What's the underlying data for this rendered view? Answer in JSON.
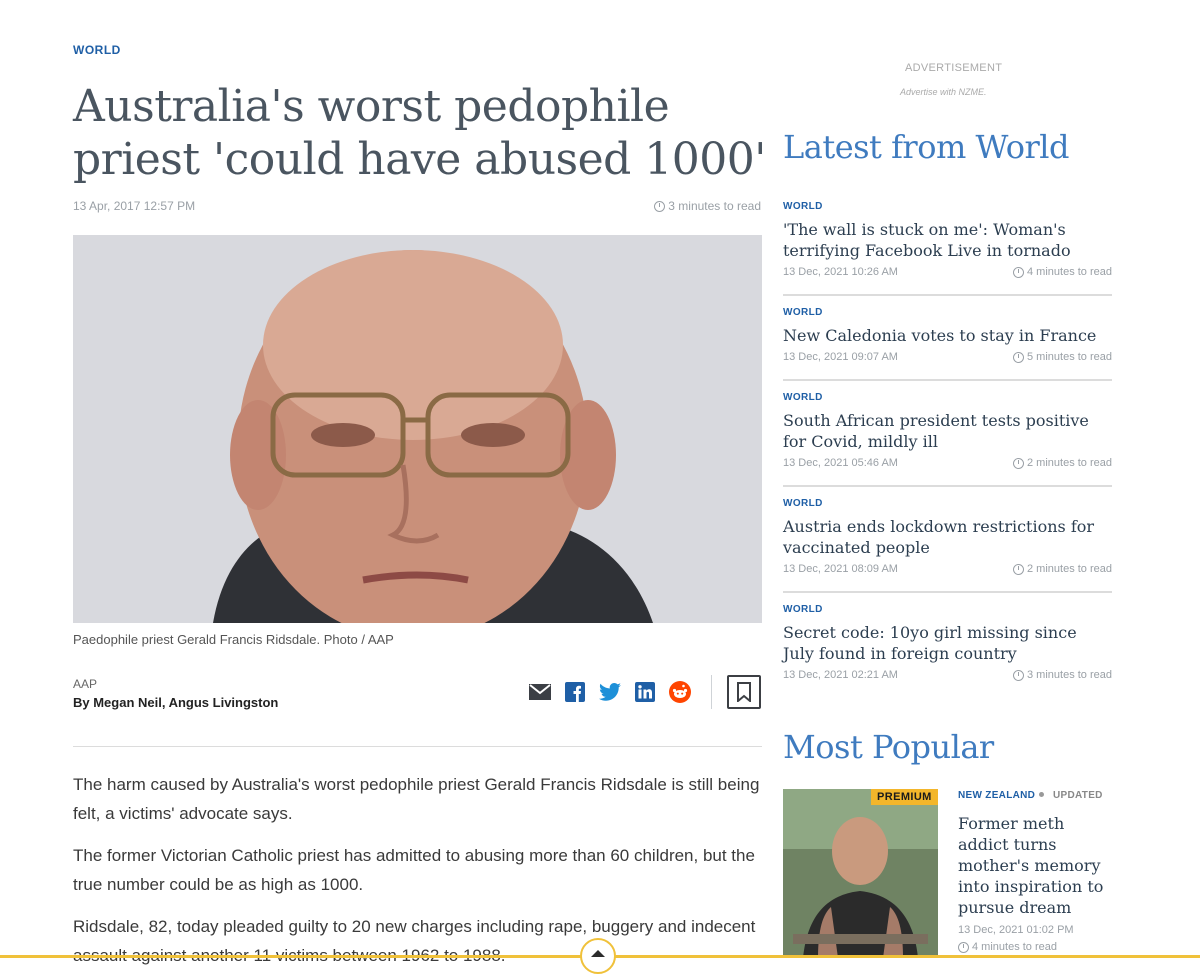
{
  "article": {
    "section": "WORLD",
    "headline": "Australia's worst pedophile priest 'could have abused 1000'",
    "date": "13 Apr, 2017 12:57 PM",
    "read_time": "3 minutes to read",
    "caption": "Paedophile priest Gerald Francis Ridsdale. Photo / AAP",
    "source": "AAP",
    "byline": "By Megan Neil, Angus Livingston",
    "share_icons": [
      "email-icon",
      "facebook-icon",
      "twitter-icon",
      "linkedin-icon",
      "reddit-icon"
    ],
    "bookmark_icon": "bookmark-icon",
    "paragraphs": [
      "The harm caused by Australia's worst pedophile priest Gerald Francis Ridsdale is still being felt, a victims' advocate says.",
      "The former Victorian Catholic priest has admitted to abusing more than 60 children, but the true number could be as high as 1000.",
      "Ridsdale, 82, today pleaded guilty to 20 new charges including rape, buggery and indecent assault against another 11 victims between 1962 to 1988."
    ]
  },
  "sidebar": {
    "ad_label": "ADVERTISEMENT",
    "ad_sub": "Advertise with NZME.",
    "latest_title": "Latest from World",
    "latest": [
      {
        "tag": "WORLD",
        "title": "'The wall is stuck on me': Woman's terrifying Facebook Live in tornado",
        "date": "13 Dec, 2021 10:26 AM",
        "read": "4 minutes to read"
      },
      {
        "tag": "WORLD",
        "title": "New Caledonia votes to stay in France",
        "date": "13 Dec, 2021 09:07 AM",
        "read": "5 minutes to read"
      },
      {
        "tag": "WORLD",
        "title": "South African president tests positive for Covid, mildly ill",
        "date": "13 Dec, 2021 05:46 AM",
        "read": "2 minutes to read"
      },
      {
        "tag": "WORLD",
        "title": "Austria ends lockdown restrictions for vaccinated people",
        "date": "13 Dec, 2021 08:09 AM",
        "read": "2 minutes to read"
      },
      {
        "tag": "WORLD",
        "title": "Secret code: 10yo girl missing since July found in foreign country",
        "date": "13 Dec, 2021 02:21 AM",
        "read": "3 minutes to read"
      }
    ],
    "popular_title": "Most Popular",
    "popular": {
      "badge": "PREMIUM",
      "tag": "NEW ZEALAND",
      "status": "UPDATED",
      "title": "Former meth addict turns mother's memory into inspiration to pursue dream",
      "date": "13 Dec, 2021 01:02 PM",
      "read": "4 minutes to read"
    }
  },
  "colors": {
    "accent": "#1f5fa6",
    "sidebar_heading": "#3f7bbf",
    "premium": "#f3b62b"
  }
}
